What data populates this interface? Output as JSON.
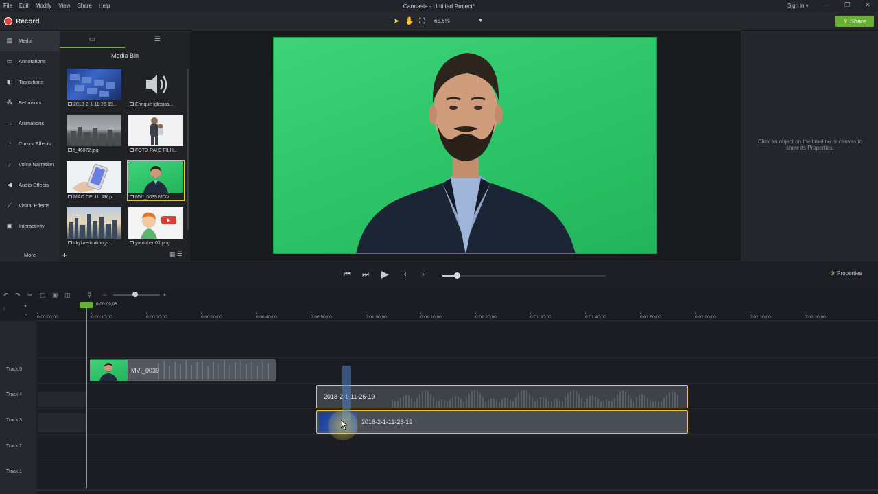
{
  "app": {
    "title": "Camtasia - Untitled Project*",
    "menu": [
      "File",
      "Edit",
      "Modify",
      "View",
      "Share",
      "Help"
    ],
    "signin": "Sign in ▾",
    "window_controls": [
      "—",
      "❐",
      "✕"
    ]
  },
  "toolbar": {
    "record_label": "Record",
    "zoom": "65.6%",
    "share_label": "Share"
  },
  "nav": {
    "items": [
      {
        "label": "Media",
        "icon": "film-icon"
      },
      {
        "label": "Annotations",
        "icon": "annotation-icon"
      },
      {
        "label": "Transitions",
        "icon": "transition-icon"
      },
      {
        "label": "Behaviors",
        "icon": "behavior-icon"
      },
      {
        "label": "Animations",
        "icon": "animation-icon"
      },
      {
        "label": "Cursor Effects",
        "icon": "cursor-icon"
      },
      {
        "label": "Voice Narration",
        "icon": "microphone-icon"
      },
      {
        "label": "Audio Effects",
        "icon": "speaker-icon"
      },
      {
        "label": "Visual Effects",
        "icon": "wand-icon"
      },
      {
        "label": "Interactivity",
        "icon": "interactivity-icon"
      }
    ],
    "more": "More"
  },
  "media_bin": {
    "title": "Media Bin",
    "items": [
      {
        "name": "2018-2-1-11-26-19..."
      },
      {
        "name": "Enrique Iglesias..."
      },
      {
        "name": "f_46872.jpg"
      },
      {
        "name": "FOTO PAI E FILH..."
      },
      {
        "name": "MAO CELULAR.p..."
      },
      {
        "name": "MVI_0039.MOV"
      },
      {
        "name": "skyline-buildings..."
      },
      {
        "name": "youtuber 01.png"
      }
    ]
  },
  "properties": {
    "hint": "Click an object on the timeline or canvas to show its Properties.",
    "button": "Properties"
  },
  "playback": {
    "progress": 0.08
  },
  "timeline": {
    "playhead": "0:00:09;06",
    "ticks": [
      "0:00:00;00",
      "0:00:10;00",
      "0:00:20;00",
      "0:00:30;00",
      "0:00:40;00",
      "0:00:50;00",
      "0:01:00;00",
      "0:01:10;00",
      "0:01:20;00",
      "0:01:30;00",
      "0:01:40;00",
      "0:01:50;00",
      "0:02:00;00",
      "0:02:10;00",
      "0:02:20;00"
    ],
    "tracks": [
      "Track 5",
      "Track 4",
      "Track 3",
      "Track 2",
      "Track 1"
    ],
    "clips": {
      "track5": "MVI_0039",
      "track4": "2018-2-1-11-26-19",
      "track3": "2018-2-1-11-26-19"
    }
  }
}
